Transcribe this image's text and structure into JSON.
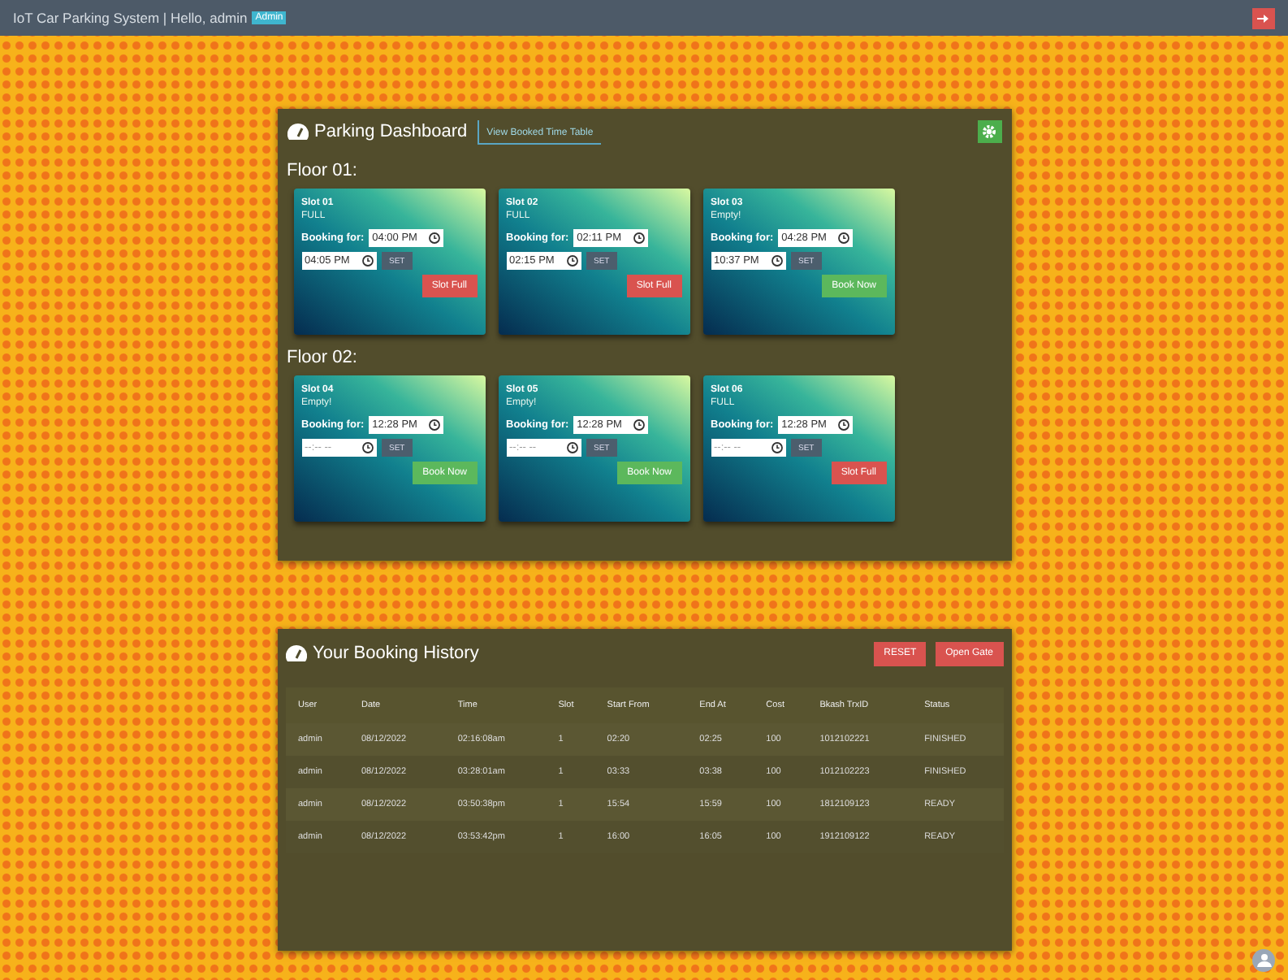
{
  "topbar": {
    "title": "IoT Car Parking System | Hello, admin",
    "badge": "Admin"
  },
  "dashboard": {
    "title": "Parking Dashboard",
    "link": "View Booked Time Table",
    "floors": [
      {
        "title": "Floor 01:",
        "slots": [
          {
            "name": "Slot 01",
            "status": "FULL",
            "label": "Booking for:",
            "start": "04:00 PM",
            "end": "04:05 PM",
            "set": "SET",
            "action": {
              "kind": "danger",
              "label": "Slot Full"
            }
          },
          {
            "name": "Slot 02",
            "status": "FULL",
            "label": "Booking for:",
            "start": "02:11 PM",
            "end": "02:15 PM",
            "set": "SET",
            "action": {
              "kind": "danger",
              "label": "Slot Full"
            }
          },
          {
            "name": "Slot 03",
            "status": "Empty!",
            "label": "Booking for:",
            "start": "04:28 PM",
            "end": "10:37 PM",
            "set": "SET",
            "action": {
              "kind": "success",
              "label": "Book Now"
            }
          }
        ]
      },
      {
        "title": "Floor 02:",
        "slots": [
          {
            "name": "Slot 04",
            "status": "Empty!",
            "label": "Booking for:",
            "start": "12:28 PM",
            "end_placeholder": "--:-- --",
            "set": "SET",
            "action": {
              "kind": "success",
              "label": "Book Now"
            }
          },
          {
            "name": "Slot 05",
            "status": "Empty!",
            "label": "Booking for:",
            "start": "12:28 PM",
            "end_placeholder": "--:-- --",
            "set": "SET",
            "action": {
              "kind": "success",
              "label": "Book Now"
            }
          },
          {
            "name": "Slot 06",
            "status": "FULL",
            "label": "Booking for:",
            "start": "12:28 PM",
            "end_placeholder": "--:-- --",
            "set": "SET",
            "action": {
              "kind": "danger",
              "label": "Slot Full"
            }
          }
        ]
      }
    ]
  },
  "history": {
    "title": "Your Booking History",
    "buttons": [
      "RESET",
      "Open Gate"
    ],
    "columns": [
      "User",
      "Date",
      "Time",
      "Slot",
      "Start From",
      "End At",
      "Cost",
      "Bkash TrxID",
      "Status"
    ],
    "rows": [
      [
        "admin",
        "08/12/2022",
        "02:16:08am",
        "1",
        "02:20",
        "02:25",
        "100",
        "1012102221",
        "FINISHED"
      ],
      [
        "admin",
        "08/12/2022",
        "03:28:01am",
        "1",
        "03:33",
        "03:38",
        "100",
        "1012102223",
        "FINISHED"
      ],
      [
        "admin",
        "08/12/2022",
        "03:50:38pm",
        "1",
        "15:54",
        "15:59",
        "100",
        "1812109123",
        "READY"
      ],
      [
        "admin",
        "08/12/2022",
        "03:53:42pm",
        "1",
        "16:00",
        "16:05",
        "100",
        "1912109122",
        "READY"
      ]
    ]
  }
}
